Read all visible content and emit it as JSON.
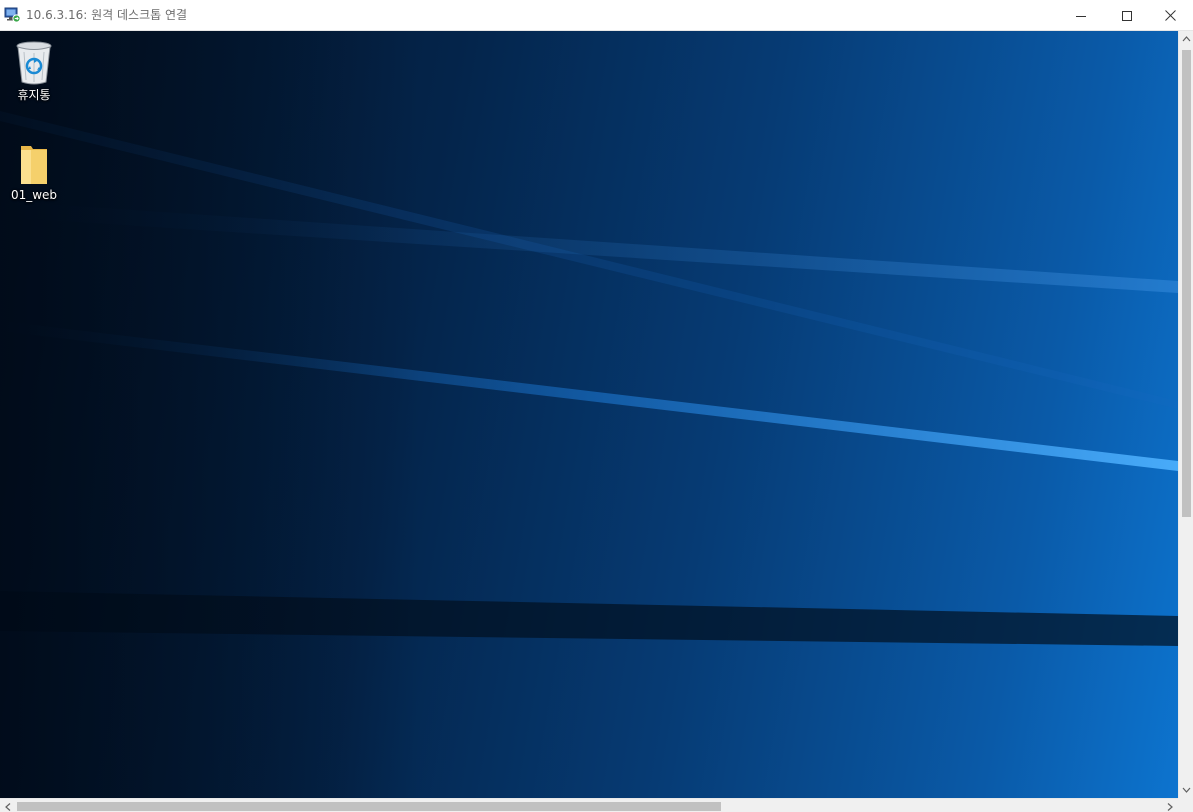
{
  "window": {
    "title": "10.6.3.16: 원격 데스크톱 연결",
    "app_icon": "remote-desktop-icon",
    "controls": {
      "minimize_icon": "minimize-icon",
      "maximize_icon": "maximize-icon",
      "close_icon": "close-icon"
    }
  },
  "desktop": {
    "icons": [
      {
        "label": "휴지통",
        "icon": "recycle-bin-icon"
      },
      {
        "label": "01_web",
        "icon": "folder-icon"
      }
    ]
  },
  "scrollbars": {
    "vertical_position": 0,
    "horizontal_position": 0
  },
  "colors": {
    "wallpaper_dark": "#021327",
    "wallpaper_light": "#0d74cf",
    "folder": "#f5d06b",
    "scroll_thumb": "#c1c1c1"
  }
}
